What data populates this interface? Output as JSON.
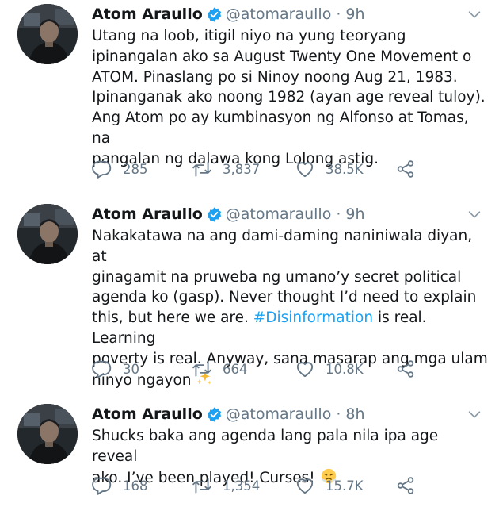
{
  "colors": {
    "text": "#14171a",
    "muted": "#657786",
    "accent": "#1da1f2"
  },
  "tweets": [
    {
      "author_name": "Atom Araullo",
      "handle": "@atomaraullo",
      "separator": "·",
      "time": "9h",
      "verified": true,
      "text_lines": [
        "Utang na loob, itigil niyo na yung teoryang",
        "ipinangalan ako sa August Twenty One Movement o",
        "ATOM. Pinaslang po si Ninoy noong Aug 21, 1983.",
        "Ipinanganak ako noong 1982 (ayan age reveal tuloy).",
        "Ang Atom po ay kumbinasyon ng Alfonso at Tomas, na",
        "pangalan ng dalawa kong Lolong astig."
      ],
      "replies": "285",
      "retweets": "3,837",
      "likes": "38.5K",
      "icons": [
        "reply-icon",
        "retweet-icon",
        "like-icon",
        "share-icon"
      ]
    },
    {
      "author_name": "Atom Araullo",
      "handle": "@atomaraullo",
      "separator": "·",
      "time": "9h",
      "verified": true,
      "text_lines": [
        "Nakakatawa na ang dami-daming naniniwala diyan, at",
        "ginagamit na pruweba ng umano’y secret political",
        "agenda ko (gasp). Never thought I’d need to explain",
        "this, but here we are. ",
        "#Disinformation",
        " is real. Learning",
        "poverty is real. Anyway, sana masarap ang mga ulam",
        "ninyo ngayon "
      ],
      "emoji": "sparkles",
      "replies": "30",
      "retweets": "664",
      "likes": "10.8K",
      "icons": [
        "reply-icon",
        "retweet-icon",
        "like-icon",
        "share-icon"
      ]
    },
    {
      "author_name": "Atom Araullo",
      "handle": "@atomaraullo",
      "separator": "·",
      "time": "8h",
      "verified": true,
      "text_lines": [
        "Shucks baka ang agenda lang pala nila ipa age reveal",
        "ako. I’ve been played! Curses! "
      ],
      "emoji": "face-with-steam-from-nose",
      "replies": "168",
      "retweets": "1,354",
      "likes": "15.7K",
      "icons": [
        "reply-icon",
        "retweet-icon",
        "like-icon",
        "share-icon"
      ]
    }
  ]
}
